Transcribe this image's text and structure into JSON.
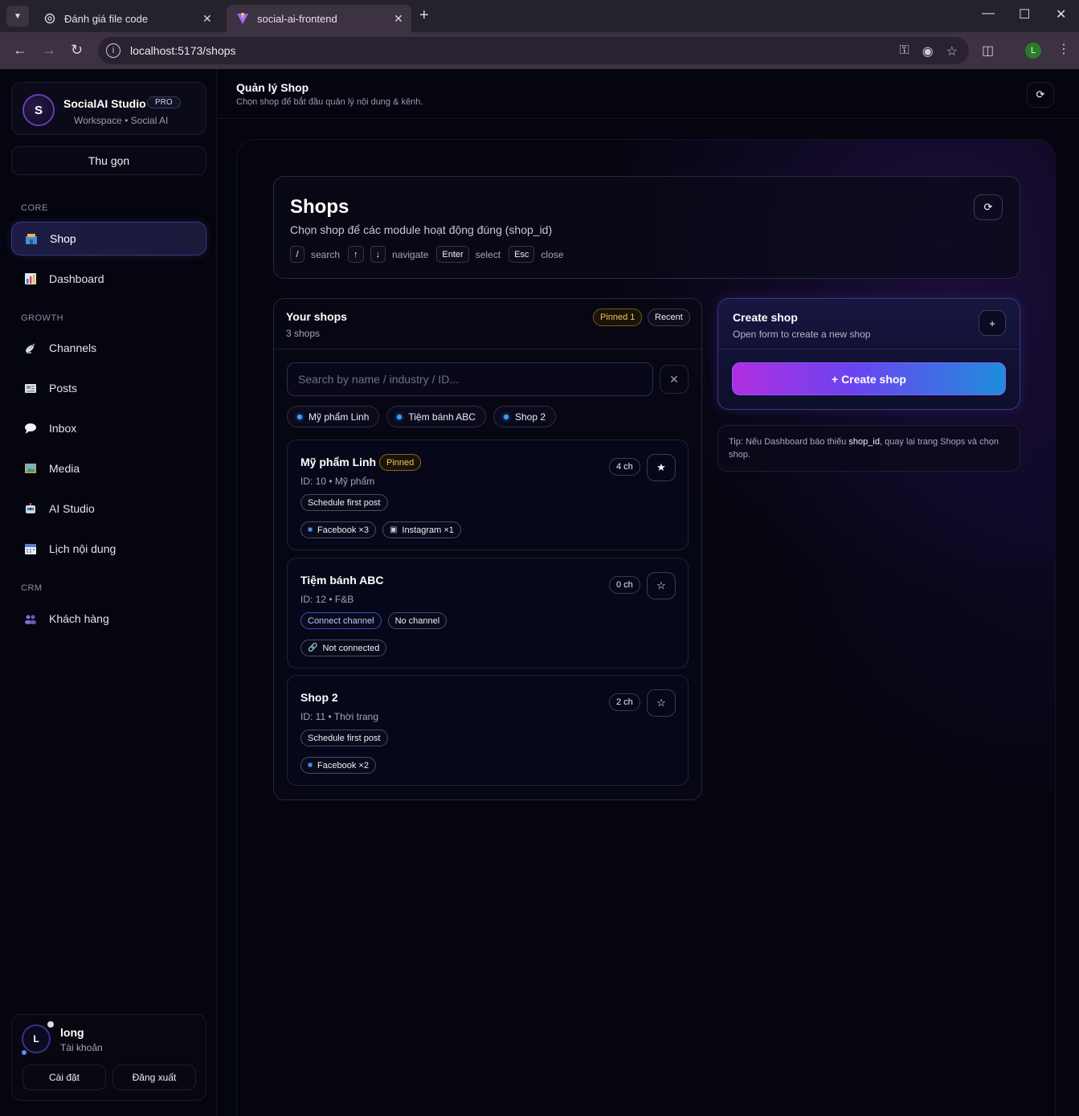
{
  "browser": {
    "tabs": [
      {
        "title": "Đánh giá file code"
      },
      {
        "title": "social-ai-frontend"
      }
    ],
    "url": "localhost:5173/shops",
    "profile_initial": "L"
  },
  "sidebar": {
    "brand": {
      "logo": "S",
      "name": "SocialAI Studio",
      "badge": "PRO",
      "sub": "Workspace • Social AI"
    },
    "collapse_label": "Thu gọn",
    "sections": {
      "core": "CORE",
      "growth": "GROWTH",
      "crm": "CRM"
    },
    "items": [
      {
        "label": "Shop",
        "icon": "shop-icon",
        "active": true
      },
      {
        "label": "Dashboard",
        "icon": "chart-icon"
      },
      {
        "label": "Channels",
        "icon": "satellite-icon"
      },
      {
        "label": "Posts",
        "icon": "newspaper-icon"
      },
      {
        "label": "Inbox",
        "icon": "speech-bubble-icon"
      },
      {
        "label": "Media",
        "icon": "picture-icon"
      },
      {
        "label": "AI Studio",
        "icon": "robot-icon"
      },
      {
        "label": "Lịch nội dung",
        "icon": "calendar-icon"
      },
      {
        "label": "Khách hàng",
        "icon": "people-icon"
      }
    ],
    "user": {
      "initial": "L",
      "name": "long",
      "sub": "Tài khoản",
      "settings": "Cài đặt",
      "logout": "Đăng xuất"
    }
  },
  "header": {
    "title": "Quản lý Shop",
    "subtitle": "Chọn shop để bắt đầu quản lý nội dung & kênh."
  },
  "hero": {
    "title": "Shops",
    "subtitle": "Chọn shop để các module hoạt động đúng (shop_id)",
    "hints": {
      "slash": "/",
      "search": "search",
      "up": "↑",
      "down": "↓",
      "navigate": "navigate",
      "enter": "Enter",
      "select": "select",
      "esc": "Esc",
      "close": "close"
    }
  },
  "shops_panel": {
    "title": "Your shops",
    "count": "3 shops",
    "pinned_pill": "Pinned 1",
    "recent_pill": "Recent",
    "search_placeholder": "Search by name / industry / ID...",
    "chips": [
      "Mỹ phẩm Linh",
      "Tiệm bánh ABC",
      "Shop 2"
    ],
    "shops": [
      {
        "name": "Mỹ phẩm Linh",
        "pinned": "Pinned",
        "meta": "ID: 10 • Mỹ phẩm",
        "channels": "4 ch",
        "tags": [
          "Schedule first post"
        ],
        "platforms": [
          {
            "icon": "facebook-icon",
            "label": "Facebook ×3"
          },
          {
            "icon": "camera-icon",
            "label": "Instagram ×1"
          }
        ]
      },
      {
        "name": "Tiệm bánh ABC",
        "meta": "ID: 12 • F&B",
        "channels": "0 ch",
        "tags": [
          "Connect channel",
          "No channel"
        ],
        "platforms": [
          {
            "icon": "link-icon",
            "label": "Not connected"
          }
        ]
      },
      {
        "name": "Shop 2",
        "meta": "ID: 11 • Thời trang",
        "channels": "2 ch",
        "tags": [
          "Schedule first post"
        ],
        "platforms": [
          {
            "icon": "facebook-icon",
            "label": "Facebook ×2"
          }
        ]
      }
    ]
  },
  "create": {
    "title": "Create shop",
    "subtitle": "Open form to create a new shop",
    "plus": "+",
    "button": "+ Create shop"
  },
  "tip": {
    "prefix": "Tip: Nếu Dashboard báo thiếu ",
    "code": "shop_id",
    "suffix": ", quay lại trang Shops và chọn shop."
  }
}
